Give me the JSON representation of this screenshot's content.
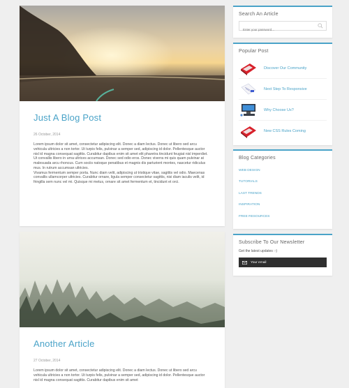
{
  "posts": [
    {
      "title": "Just A Blog Post",
      "date": "26 October, 2014",
      "paragraphs": [
        "Lorem ipsum dolor sit amet, consectetur adipiscing elit. Donec a diam lectus. Donec ut libero sed arcu vehicula ultricies a non tortor. Ut turpis felis, pulvinar a semper sed, adipiscing id dolor. Pellentesque auctor nisl id magna consequat sagittis. Curabitur dapibus enim sit amet elit pharetra tincidunt feugiat nisl imperdiet. Ut convallis libero in urna ultrices accumsan. Donec sed odio eros. Donec viverra mi quis quam pulvinar at malesuada arcu rhoncus. Cum sociis natoque penatibus et magnis dis parturient montes, nascetur ridiculus mus. In rutrum accumsan ultricies.",
        "Vivamus fermentum semper porta. Nunc diam velit, adipiscing ut tristique vitae, sagittis vel odio. Maecenas convallis ullamcorper ultricies. Curabitur ornare, ligula semper consectetur sagittis, nisi diam iaculis velit, id fringilla sem nunc vel mi. Quisque mi metus, ornare sit amet fermentum et, tincidunt et orci."
      ]
    },
    {
      "title": "Another Article",
      "date": "27 October, 2014",
      "paragraphs": [
        "Lorem ipsum dolor sit amet, consectetur adipiscing elit. Donec a diam lectus. Donec ut libero sed arcu vehicula ultricies a non tortor. Ut turpis felis, pulvinar a semper sed, adipiscing id dolor. Pellentesque auctor nisl id magna consequat sagittis. Curabitur dapibus enim sit amet"
      ]
    }
  ],
  "search": {
    "title": "Search An Article",
    "placeholder": "Enter your password..."
  },
  "popular": {
    "title": "Popular Post",
    "items": [
      {
        "label": "Discover Our Community",
        "icon": "red-book-icon"
      },
      {
        "label": "Next Step To Responsive",
        "icon": "document-icon"
      },
      {
        "label": "Why Choose Us?",
        "icon": "computer-icon"
      },
      {
        "label": "New CSS Rules Coming",
        "icon": "red-book-icon"
      }
    ]
  },
  "categories": {
    "title": "Blog Categories",
    "items": [
      "Web Design",
      "Tutorials",
      "Last Trends",
      "Inspiration",
      "Free Resources"
    ]
  },
  "newsletter": {
    "title": "Subscribe To Our Newsletter",
    "subtitle": "Get the latest updates :-)",
    "button": "Your email"
  },
  "colors": {
    "accent": "#4aa3c8",
    "background": "#efefef",
    "dark_button": "#2f2f2f"
  }
}
